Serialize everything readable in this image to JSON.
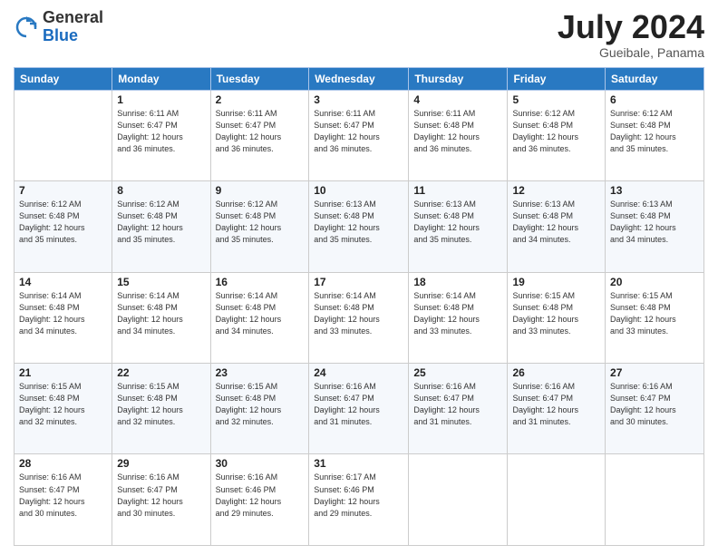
{
  "header": {
    "logo_general": "General",
    "logo_blue": "Blue",
    "title": "July 2024",
    "location": "Gueibale, Panama"
  },
  "days_of_week": [
    "Sunday",
    "Monday",
    "Tuesday",
    "Wednesday",
    "Thursday",
    "Friday",
    "Saturday"
  ],
  "weeks": [
    [
      {
        "day": "",
        "info": ""
      },
      {
        "day": "1",
        "info": "Sunrise: 6:11 AM\nSunset: 6:47 PM\nDaylight: 12 hours\nand 36 minutes."
      },
      {
        "day": "2",
        "info": "Sunrise: 6:11 AM\nSunset: 6:47 PM\nDaylight: 12 hours\nand 36 minutes."
      },
      {
        "day": "3",
        "info": "Sunrise: 6:11 AM\nSunset: 6:47 PM\nDaylight: 12 hours\nand 36 minutes."
      },
      {
        "day": "4",
        "info": "Sunrise: 6:11 AM\nSunset: 6:48 PM\nDaylight: 12 hours\nand 36 minutes."
      },
      {
        "day": "5",
        "info": "Sunrise: 6:12 AM\nSunset: 6:48 PM\nDaylight: 12 hours\nand 36 minutes."
      },
      {
        "day": "6",
        "info": "Sunrise: 6:12 AM\nSunset: 6:48 PM\nDaylight: 12 hours\nand 35 minutes."
      }
    ],
    [
      {
        "day": "7",
        "info": "Sunrise: 6:12 AM\nSunset: 6:48 PM\nDaylight: 12 hours\nand 35 minutes."
      },
      {
        "day": "8",
        "info": "Sunrise: 6:12 AM\nSunset: 6:48 PM\nDaylight: 12 hours\nand 35 minutes."
      },
      {
        "day": "9",
        "info": "Sunrise: 6:12 AM\nSunset: 6:48 PM\nDaylight: 12 hours\nand 35 minutes."
      },
      {
        "day": "10",
        "info": "Sunrise: 6:13 AM\nSunset: 6:48 PM\nDaylight: 12 hours\nand 35 minutes."
      },
      {
        "day": "11",
        "info": "Sunrise: 6:13 AM\nSunset: 6:48 PM\nDaylight: 12 hours\nand 35 minutes."
      },
      {
        "day": "12",
        "info": "Sunrise: 6:13 AM\nSunset: 6:48 PM\nDaylight: 12 hours\nand 34 minutes."
      },
      {
        "day": "13",
        "info": "Sunrise: 6:13 AM\nSunset: 6:48 PM\nDaylight: 12 hours\nand 34 minutes."
      }
    ],
    [
      {
        "day": "14",
        "info": "Sunrise: 6:14 AM\nSunset: 6:48 PM\nDaylight: 12 hours\nand 34 minutes."
      },
      {
        "day": "15",
        "info": "Sunrise: 6:14 AM\nSunset: 6:48 PM\nDaylight: 12 hours\nand 34 minutes."
      },
      {
        "day": "16",
        "info": "Sunrise: 6:14 AM\nSunset: 6:48 PM\nDaylight: 12 hours\nand 34 minutes."
      },
      {
        "day": "17",
        "info": "Sunrise: 6:14 AM\nSunset: 6:48 PM\nDaylight: 12 hours\nand 33 minutes."
      },
      {
        "day": "18",
        "info": "Sunrise: 6:14 AM\nSunset: 6:48 PM\nDaylight: 12 hours\nand 33 minutes."
      },
      {
        "day": "19",
        "info": "Sunrise: 6:15 AM\nSunset: 6:48 PM\nDaylight: 12 hours\nand 33 minutes."
      },
      {
        "day": "20",
        "info": "Sunrise: 6:15 AM\nSunset: 6:48 PM\nDaylight: 12 hours\nand 33 minutes."
      }
    ],
    [
      {
        "day": "21",
        "info": "Sunrise: 6:15 AM\nSunset: 6:48 PM\nDaylight: 12 hours\nand 32 minutes."
      },
      {
        "day": "22",
        "info": "Sunrise: 6:15 AM\nSunset: 6:48 PM\nDaylight: 12 hours\nand 32 minutes."
      },
      {
        "day": "23",
        "info": "Sunrise: 6:15 AM\nSunset: 6:48 PM\nDaylight: 12 hours\nand 32 minutes."
      },
      {
        "day": "24",
        "info": "Sunrise: 6:16 AM\nSunset: 6:47 PM\nDaylight: 12 hours\nand 31 minutes."
      },
      {
        "day": "25",
        "info": "Sunrise: 6:16 AM\nSunset: 6:47 PM\nDaylight: 12 hours\nand 31 minutes."
      },
      {
        "day": "26",
        "info": "Sunrise: 6:16 AM\nSunset: 6:47 PM\nDaylight: 12 hours\nand 31 minutes."
      },
      {
        "day": "27",
        "info": "Sunrise: 6:16 AM\nSunset: 6:47 PM\nDaylight: 12 hours\nand 30 minutes."
      }
    ],
    [
      {
        "day": "28",
        "info": "Sunrise: 6:16 AM\nSunset: 6:47 PM\nDaylight: 12 hours\nand 30 minutes."
      },
      {
        "day": "29",
        "info": "Sunrise: 6:16 AM\nSunset: 6:47 PM\nDaylight: 12 hours\nand 30 minutes."
      },
      {
        "day": "30",
        "info": "Sunrise: 6:16 AM\nSunset: 6:46 PM\nDaylight: 12 hours\nand 29 minutes."
      },
      {
        "day": "31",
        "info": "Sunrise: 6:17 AM\nSunset: 6:46 PM\nDaylight: 12 hours\nand 29 minutes."
      },
      {
        "day": "",
        "info": ""
      },
      {
        "day": "",
        "info": ""
      },
      {
        "day": "",
        "info": ""
      }
    ]
  ]
}
